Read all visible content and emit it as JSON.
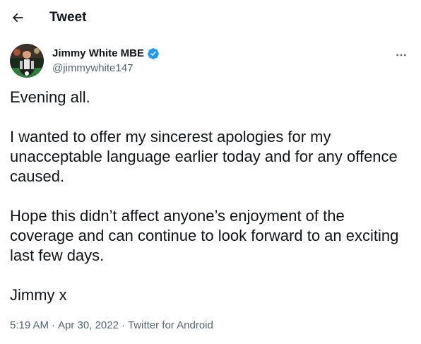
{
  "header": {
    "back_icon": "arrow-left-icon",
    "title": "Tweet"
  },
  "author": {
    "avatar_icon": "avatar-photo",
    "display_name": "Jimmy White MBE",
    "verified_icon": "verified-badge-icon",
    "handle": "@jimmywhite147",
    "more_icon": "more-horizontal-icon"
  },
  "tweet": {
    "paragraphs": [
      "Evening all.",
      "I wanted to offer my sincerest apologies for my unacceptable language earlier today and for any offence caused.",
      "Hope this didn’t affect anyone’s enjoyment of the coverage and can continue to look forward to an exciting last few days.",
      "Jimmy x"
    ]
  },
  "meta": {
    "time": "5:19 AM",
    "separator": "·",
    "date": "Apr 30, 2022",
    "source": "Twitter for Android"
  },
  "colors": {
    "text": "#0f1419",
    "secondary": "#536471",
    "verified": "#1d9bf0"
  }
}
